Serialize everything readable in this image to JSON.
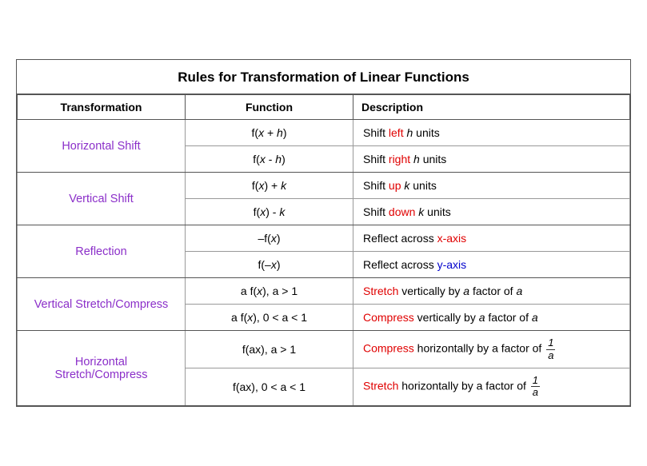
{
  "title": "Rules for Transformation of Linear Functions",
  "headers": {
    "transformation": "Transformation",
    "function": "Function",
    "description": "Description"
  },
  "rows": [
    {
      "group": "Horizontal Shift",
      "groupColor": "purple",
      "entries": [
        {
          "function": "f(x + h)",
          "description": "Shift left h units",
          "highlight": "left",
          "highlightColor": "red"
        },
        {
          "function": "f(x  - h)",
          "description": "Shift right h units",
          "highlight": "right",
          "highlightColor": "red"
        }
      ]
    },
    {
      "group": "Vertical Shift",
      "groupColor": "purple",
      "entries": [
        {
          "function": "f(x) + k",
          "description": "Shift up k units",
          "highlight": "up",
          "highlightColor": "red"
        },
        {
          "function": "f(x) - k",
          "description": "Shift down k units",
          "highlight": "down",
          "highlightColor": "red"
        }
      ]
    },
    {
      "group": "Reflection",
      "groupColor": "purple",
      "entries": [
        {
          "function": "–f(x)",
          "description": "Reflect across x-axis",
          "highlight": "x-axis",
          "highlightColor": "red"
        },
        {
          "function": "f(–x)",
          "description": "Reflect across y-axis",
          "highlight": "y-axis",
          "highlightColor": "blue"
        }
      ]
    },
    {
      "group": "Vertical Stretch/Compress",
      "groupColor": "purple",
      "entries": [
        {
          "function": "a f(x), a > 1",
          "description": "Stretch vertically by a factor of a",
          "highlight": "Stretch",
          "highlightColor": "red"
        },
        {
          "function": "a f(x), 0 < a < 1",
          "description": "Compress vertically by a factor of a",
          "highlight": "Compress",
          "highlightColor": "red"
        }
      ]
    },
    {
      "group": "Horizontal Stretch/Compress",
      "groupColor": "purple",
      "entries": [
        {
          "function": "f(ax), a > 1",
          "descriptionParts": [
            "Compress",
            " horizontally by a factor of ",
            "1/a"
          ],
          "highlight": "Compress",
          "highlightColor": "red",
          "hasFraction": true
        },
        {
          "function": "f(ax), 0 < a < 1",
          "descriptionParts": [
            "Stretch",
            " horizontally by a factor of ",
            "1/a"
          ],
          "highlight": "Stretch",
          "highlightColor": "red",
          "hasFraction": true
        }
      ]
    }
  ]
}
